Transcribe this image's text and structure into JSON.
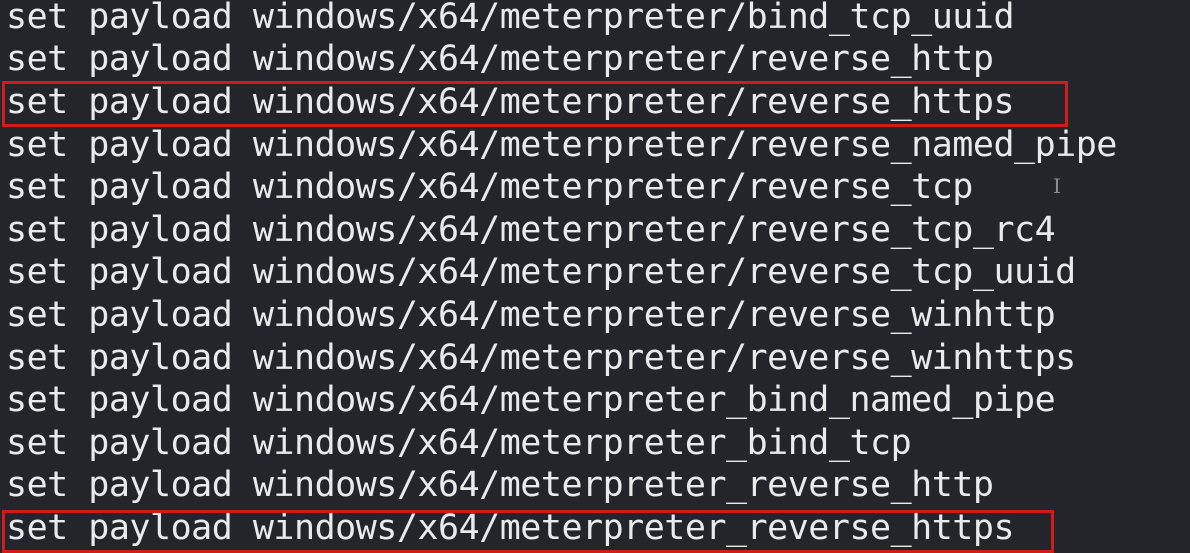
{
  "terminal": {
    "lines": [
      "set payload windows/x64/meterpreter/bind_tcp_uuid",
      "set payload windows/x64/meterpreter/reverse_http",
      "set payload windows/x64/meterpreter/reverse_https",
      "set payload windows/x64/meterpreter/reverse_named_pipe",
      "set payload windows/x64/meterpreter/reverse_tcp",
      "set payload windows/x64/meterpreter/reverse_tcp_rc4",
      "set payload windows/x64/meterpreter/reverse_tcp_uuid",
      "set payload windows/x64/meterpreter/reverse_winhttp",
      "set payload windows/x64/meterpreter/reverse_winhttps",
      "set payload windows/x64/meterpreter_bind_named_pipe",
      "set payload windows/x64/meterpreter_bind_tcp",
      "set payload windows/x64/meterpreter_reverse_http",
      "set payload windows/x64/meterpreter_reverse_https"
    ],
    "highlighted_lines": [
      2,
      12
    ],
    "cursor_glyph": "I"
  },
  "colors": {
    "background": "#23252b",
    "text": "#e9eaec",
    "highlight_border": "#d11a1a"
  }
}
